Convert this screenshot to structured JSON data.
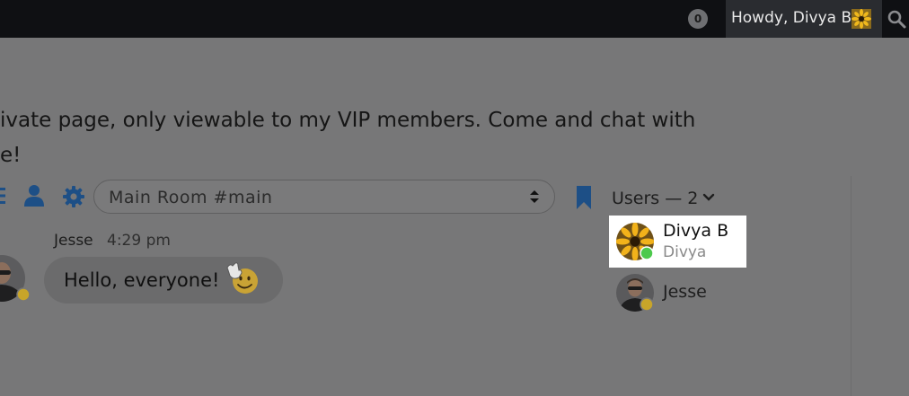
{
  "adminbar": {
    "notifications_count": "0",
    "howdy_label": "Howdy, Divya B"
  },
  "page": {
    "text_line1": "ivate page, only viewable to my VIP members. Come and chat with",
    "text_line2": "e!"
  },
  "chat": {
    "room_select_value": "Main Room #main",
    "users_header": "Users — 2",
    "users": [
      {
        "name": "Divya B",
        "subtitle": "Divya",
        "status": "online"
      },
      {
        "name": "Jesse",
        "status": "away"
      }
    ],
    "messages": [
      {
        "author": "Jesse",
        "time": "4:29 pm",
        "text": "Hello, everyone!"
      }
    ]
  },
  "colors": {
    "online": "#4cc94c",
    "away": "#c8a52a",
    "icon_blue": "#1d4f86"
  }
}
